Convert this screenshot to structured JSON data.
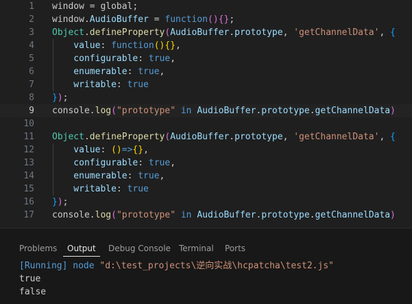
{
  "editor": {
    "lines": [
      {
        "n": "1",
        "tokens": [
          {
            "t": "window",
            "c": "t-plain"
          },
          {
            "t": " = ",
            "c": "t-plain"
          },
          {
            "t": "global",
            "c": "t-plain"
          },
          {
            "t": ";",
            "c": "t-plain"
          }
        ]
      },
      {
        "n": "2",
        "tokens": [
          {
            "t": "window",
            "c": "t-plain"
          },
          {
            "t": ".",
            "c": "t-plain"
          },
          {
            "t": "AudioBuffer",
            "c": "t-var"
          },
          {
            "t": " = ",
            "c": "t-plain"
          },
          {
            "t": "function",
            "c": "t-kw"
          },
          {
            "t": "()",
            "c": "t-b2"
          },
          {
            "t": "{}",
            "c": "t-b2"
          },
          {
            "t": ";",
            "c": "t-plain"
          }
        ]
      },
      {
        "n": "3",
        "tokens": [
          {
            "t": "Object",
            "c": "t-class"
          },
          {
            "t": ".",
            "c": "t-plain"
          },
          {
            "t": "defineProperty",
            "c": "t-fn"
          },
          {
            "t": "(",
            "c": "t-b2"
          },
          {
            "t": "AudioBuffer",
            "c": "t-var"
          },
          {
            "t": ".",
            "c": "t-plain"
          },
          {
            "t": "prototype",
            "c": "t-var"
          },
          {
            "t": ", ",
            "c": "t-plain"
          },
          {
            "t": "'getChannelData'",
            "c": "t-str"
          },
          {
            "t": ", ",
            "c": "t-plain"
          },
          {
            "t": "{",
            "c": "t-b3"
          }
        ]
      },
      {
        "n": "4",
        "tokens": [
          {
            "t": "    value",
            "c": "t-prop"
          },
          {
            "t": ": ",
            "c": "t-plain"
          },
          {
            "t": "function",
            "c": "t-kw"
          },
          {
            "t": "()",
            "c": "t-b1"
          },
          {
            "t": "{}",
            "c": "t-b1"
          },
          {
            "t": ",",
            "c": "t-plain"
          }
        ]
      },
      {
        "n": "5",
        "tokens": [
          {
            "t": "    configurable",
            "c": "t-prop"
          },
          {
            "t": ": ",
            "c": "t-plain"
          },
          {
            "t": "true",
            "c": "t-const"
          },
          {
            "t": ",",
            "c": "t-plain"
          }
        ]
      },
      {
        "n": "6",
        "tokens": [
          {
            "t": "    enumerable",
            "c": "t-prop"
          },
          {
            "t": ": ",
            "c": "t-plain"
          },
          {
            "t": "true",
            "c": "t-const"
          },
          {
            "t": ",",
            "c": "t-plain"
          }
        ]
      },
      {
        "n": "7",
        "tokens": [
          {
            "t": "    writable",
            "c": "t-prop"
          },
          {
            "t": ": ",
            "c": "t-plain"
          },
          {
            "t": "true",
            "c": "t-const"
          }
        ]
      },
      {
        "n": "8",
        "tokens": [
          {
            "t": "}",
            "c": "t-b3"
          },
          {
            "t": ")",
            "c": "t-b2"
          },
          {
            "t": ";",
            "c": "t-plain"
          }
        ]
      },
      {
        "n": "9",
        "tokens": [
          {
            "t": "console",
            "c": "t-plain"
          },
          {
            "t": ".",
            "c": "t-plain"
          },
          {
            "t": "log",
            "c": "t-fn"
          },
          {
            "t": "(",
            "c": "t-b2"
          },
          {
            "t": "\"prototype\"",
            "c": "t-str"
          },
          {
            "t": " in ",
            "c": "t-kw"
          },
          {
            "t": "AudioBuffer",
            "c": "t-var"
          },
          {
            "t": ".",
            "c": "t-plain"
          },
          {
            "t": "prototype",
            "c": "t-var"
          },
          {
            "t": ".",
            "c": "t-plain"
          },
          {
            "t": "getChannelData",
            "c": "t-var"
          },
          {
            "t": ")",
            "c": "t-b2"
          }
        ],
        "current": true
      },
      {
        "n": "10",
        "tokens": []
      },
      {
        "n": "11",
        "tokens": [
          {
            "t": "Object",
            "c": "t-class"
          },
          {
            "t": ".",
            "c": "t-plain"
          },
          {
            "t": "defineProperty",
            "c": "t-fn"
          },
          {
            "t": "(",
            "c": "t-b2"
          },
          {
            "t": "AudioBuffer",
            "c": "t-var"
          },
          {
            "t": ".",
            "c": "t-plain"
          },
          {
            "t": "prototype",
            "c": "t-var"
          },
          {
            "t": ", ",
            "c": "t-plain"
          },
          {
            "t": "'getChannelData'",
            "c": "t-str"
          },
          {
            "t": ", ",
            "c": "t-plain"
          },
          {
            "t": "{",
            "c": "t-b3"
          }
        ]
      },
      {
        "n": "12",
        "tokens": [
          {
            "t": "    value",
            "c": "t-prop"
          },
          {
            "t": ": ",
            "c": "t-plain"
          },
          {
            "t": "()",
            "c": "t-b1"
          },
          {
            "t": "=>",
            "c": "t-kw"
          },
          {
            "t": "{}",
            "c": "t-b1"
          },
          {
            "t": ",",
            "c": "t-plain"
          }
        ]
      },
      {
        "n": "13",
        "tokens": [
          {
            "t": "    configurable",
            "c": "t-prop"
          },
          {
            "t": ": ",
            "c": "t-plain"
          },
          {
            "t": "true",
            "c": "t-const"
          },
          {
            "t": ",",
            "c": "t-plain"
          }
        ]
      },
      {
        "n": "14",
        "tokens": [
          {
            "t": "    enumerable",
            "c": "t-prop"
          },
          {
            "t": ": ",
            "c": "t-plain"
          },
          {
            "t": "true",
            "c": "t-const"
          },
          {
            "t": ",",
            "c": "t-plain"
          }
        ]
      },
      {
        "n": "15",
        "tokens": [
          {
            "t": "    writable",
            "c": "t-prop"
          },
          {
            "t": ": ",
            "c": "t-plain"
          },
          {
            "t": "true",
            "c": "t-const"
          }
        ]
      },
      {
        "n": "16",
        "tokens": [
          {
            "t": "}",
            "c": "t-b3"
          },
          {
            "t": ")",
            "c": "t-b2"
          },
          {
            "t": ";",
            "c": "t-plain"
          }
        ]
      },
      {
        "n": "17",
        "tokens": [
          {
            "t": "console",
            "c": "t-plain"
          },
          {
            "t": ".",
            "c": "t-plain"
          },
          {
            "t": "log",
            "c": "t-fn"
          },
          {
            "t": "(",
            "c": "t-b2"
          },
          {
            "t": "\"prototype\"",
            "c": "t-str"
          },
          {
            "t": " in ",
            "c": "t-kw"
          },
          {
            "t": "AudioBuffer",
            "c": "t-var"
          },
          {
            "t": ".",
            "c": "t-plain"
          },
          {
            "t": "prototype",
            "c": "t-var"
          },
          {
            "t": ".",
            "c": "t-plain"
          },
          {
            "t": "getChannelData",
            "c": "t-var"
          },
          {
            "t": ")",
            "c": "t-b2"
          }
        ]
      }
    ]
  },
  "panel": {
    "tabs": {
      "problems": "Problems",
      "output": "Output",
      "debug_console": "Debug Console",
      "terminal": "Terminal",
      "ports": "Ports"
    },
    "output": {
      "running_prefix": "[Running] node ",
      "running_path": "\"d:\\test_projects\\逆向实战\\hcpatcha\\test2.js\"",
      "line1": "true",
      "line2": "false"
    }
  },
  "colors": {
    "editor_bg": "#1f1f1f",
    "panel_bg": "#181818",
    "keyword": "#569cd6",
    "string": "#ce9178",
    "variable": "#9cdcfe",
    "class": "#4ec9b0",
    "function": "#dcdcaa"
  }
}
